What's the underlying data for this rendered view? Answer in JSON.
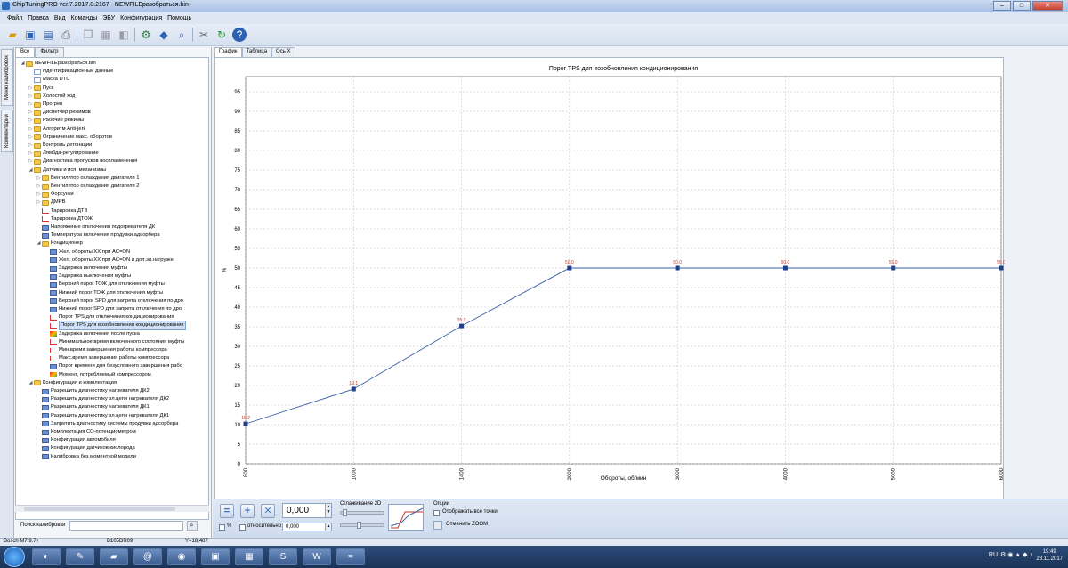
{
  "window": {
    "title": "ChipTuningPRO ver.7.2017.8.2167 - NEWFILEразобраться.bin"
  },
  "menu": [
    "Файл",
    "Правка",
    "Вид",
    "Команды",
    "ЭБУ",
    "Конфигурация",
    "Помощь"
  ],
  "left_vertical_tabs": [
    "Меню калибровок",
    "Комментарии"
  ],
  "left_tabs": [
    "Все",
    "Фильтр"
  ],
  "tree": [
    {
      "label": "NEWFILEразобраться.bin",
      "level": 0,
      "icon": "folder",
      "exp": "collapse"
    },
    {
      "label": "Идентификационные данные",
      "level": 1,
      "icon": "file",
      "exp": ""
    },
    {
      "label": "Маска DTC",
      "level": 1,
      "icon": "file",
      "exp": ""
    },
    {
      "label": "Пуск",
      "level": 1,
      "icon": "folder",
      "exp": "expand"
    },
    {
      "label": "Холостой ход",
      "level": 1,
      "icon": "folder",
      "exp": "expand"
    },
    {
      "label": "Прогрев",
      "level": 1,
      "icon": "folder",
      "exp": "expand"
    },
    {
      "label": "Диспетчер режимов",
      "level": 1,
      "icon": "folder",
      "exp": "expand"
    },
    {
      "label": "Рабочие режимы",
      "level": 1,
      "icon": "folder",
      "exp": "expand"
    },
    {
      "label": "Алгоритм Anti-jerk",
      "level": 1,
      "icon": "folder",
      "exp": "expand"
    },
    {
      "label": "Ограничение макс. оборотов",
      "level": 1,
      "icon": "folder",
      "exp": "expand"
    },
    {
      "label": "Контроль детонации",
      "level": 1,
      "icon": "folder",
      "exp": "expand"
    },
    {
      "label": "Лямбда-регулирование",
      "level": 1,
      "icon": "folder",
      "exp": "expand"
    },
    {
      "label": "Диагностика пропусков воспламенения",
      "level": 1,
      "icon": "folder",
      "exp": "expand"
    },
    {
      "label": "Датчики и исп. механизмы",
      "level": 1,
      "icon": "folder",
      "exp": "collapse"
    },
    {
      "label": "Вентилятор охлаждения двигателя 1",
      "level": 2,
      "icon": "folder",
      "exp": "expand"
    },
    {
      "label": "Вентилятор охлаждения двигателя 2",
      "level": 2,
      "icon": "folder",
      "exp": "expand"
    },
    {
      "label": "Форсунки",
      "level": 2,
      "icon": "folder",
      "exp": "expand"
    },
    {
      "label": "ДМРВ",
      "level": 2,
      "icon": "folder",
      "exp": "expand"
    },
    {
      "label": "Тарировка ДТВ",
      "level": 2,
      "icon": "chart",
      "exp": ""
    },
    {
      "label": "Тарировка ДТОЖ",
      "level": 2,
      "icon": "chart",
      "exp": ""
    },
    {
      "label": "Напряжение отключения подогревателя ДК",
      "level": 2,
      "icon": "map",
      "exp": ""
    },
    {
      "label": "Температура включения продувки адсорбера",
      "level": 2,
      "icon": "map",
      "exp": ""
    },
    {
      "label": "Кондиционер",
      "level": 2,
      "icon": "folder",
      "exp": "collapse"
    },
    {
      "label": "Жел. обороты ХХ при AC=ON",
      "level": 3,
      "icon": "map",
      "exp": ""
    },
    {
      "label": "Жел. обороты ХХ при AC=ON и доп.эл.нагрузке",
      "level": 3,
      "icon": "map",
      "exp": ""
    },
    {
      "label": "Задержка включения муфты",
      "level": 3,
      "icon": "map",
      "exp": ""
    },
    {
      "label": "Задержка выключения муфты",
      "level": 3,
      "icon": "map",
      "exp": ""
    },
    {
      "label": "Верхний порог ТОЖ для отключения муфты",
      "level": 3,
      "icon": "map",
      "exp": ""
    },
    {
      "label": "Нижний порог ТОЖ для отключения муфты",
      "level": 3,
      "icon": "map",
      "exp": ""
    },
    {
      "label": "Верхний порог SPD для запрета отключения по дро",
      "level": 3,
      "icon": "map",
      "exp": ""
    },
    {
      "label": "Нижний порог SPD для запрета отключения по дро",
      "level": 3,
      "icon": "map",
      "exp": ""
    },
    {
      "label": "Порог TPS для отключения кондиционирования",
      "level": 3,
      "icon": "chart",
      "exp": ""
    },
    {
      "label": "Порог TPS для возобновления кондиционирования",
      "level": 3,
      "icon": "chart",
      "exp": "",
      "selected": true
    },
    {
      "label": "Задержка включения после пуска",
      "level": 3,
      "icon": "chart3",
      "exp": ""
    },
    {
      "label": "Минимальное время включенного состояния муфты",
      "level": 3,
      "icon": "chart",
      "exp": ""
    },
    {
      "label": "Мин.время завершения работы компрессора",
      "level": 3,
      "icon": "chart",
      "exp": ""
    },
    {
      "label": "Макс.время завершения работы компрессора",
      "level": 3,
      "icon": "chart",
      "exp": ""
    },
    {
      "label": "Порог времени для безусловного завершения рабо",
      "level": 3,
      "icon": "map",
      "exp": ""
    },
    {
      "label": "Момент, потребляемый компрессором",
      "level": 3,
      "icon": "chart3",
      "exp": ""
    },
    {
      "label": "Конфигурация и комплектация",
      "level": 1,
      "icon": "folder",
      "exp": "collapse"
    },
    {
      "label": "Разрешить диагностику нагревателя ДК2",
      "level": 2,
      "icon": "map",
      "exp": ""
    },
    {
      "label": "Разрешить диагностику эл.цепи нагревателя ДК2",
      "level": 2,
      "icon": "map",
      "exp": ""
    },
    {
      "label": "Разрешить диагностику нагревателя ДК1",
      "level": 2,
      "icon": "map",
      "exp": ""
    },
    {
      "label": "Разрешить диагностику эл.цепи нагревателя ДК1",
      "level": 2,
      "icon": "map",
      "exp": ""
    },
    {
      "label": "Запретить диагностику системы продувки адсорбера",
      "level": 2,
      "icon": "map",
      "exp": ""
    },
    {
      "label": "Комплектация СО-потенциометром",
      "level": 2,
      "icon": "map",
      "exp": ""
    },
    {
      "label": "Конфигурация автомобиля",
      "level": 2,
      "icon": "map",
      "exp": ""
    },
    {
      "label": "Конфигурация датчиков кислорода",
      "level": 2,
      "icon": "map",
      "exp": ""
    },
    {
      "label": "Калибровка без моментной модели",
      "level": 2,
      "icon": "map",
      "exp": ""
    }
  ],
  "search": {
    "label": "Поиск калибровки",
    "value": ""
  },
  "main_tabs": [
    "График",
    "Таблица",
    "Ось X"
  ],
  "chart_data": {
    "type": "line",
    "title": "Порог TPS для возобновления кондиционирования",
    "xlabel": "Обороты, об/мин",
    "ylabel": "%",
    "x": [
      800,
      1000,
      1400,
      2000,
      3000,
      4000,
      5000,
      6000
    ],
    "y": [
      10.2,
      19.1,
      35.2,
      50.0,
      50.0,
      50.0,
      50.0,
      50.0
    ],
    "point_labels": [
      "10.2",
      "19.1",
      "35.2",
      "50.0",
      "50.0",
      "50.0",
      "50.0",
      "50.0"
    ],
    "ylim": [
      0,
      95
    ],
    "yticks": [
      0,
      5,
      10,
      15,
      20,
      25,
      30,
      35,
      40,
      45,
      50,
      55,
      60,
      65,
      70,
      75,
      80,
      85,
      90,
      95
    ],
    "xtick_labels": [
      "800",
      "1000",
      "1400",
      "2000",
      "3000",
      "4000",
      "5000",
      "6000"
    ],
    "x_axis": "categorical-equal-spacing",
    "grid": true,
    "line_color": "#3d5fa8",
    "marker_color": "#1f3f8a",
    "label_color": "#c0392b"
  },
  "bottom": {
    "value": "0,000",
    "percent_label": "%",
    "relative_label": "относительно",
    "relative_value": "0,000",
    "smoothing_label": "Сглаживание 2D",
    "options_label": "Опции",
    "show_points_label": "Отображать все точки",
    "undo_zoom_label": "Отменить ZOOM"
  },
  "status": {
    "ecu": "Bosch M7.9.7+",
    "code": "B105DR09",
    "coord": "Y=18,487"
  },
  "taskbar": {
    "lang": "RU",
    "time": "19:49",
    "date": "28.11.2017"
  }
}
